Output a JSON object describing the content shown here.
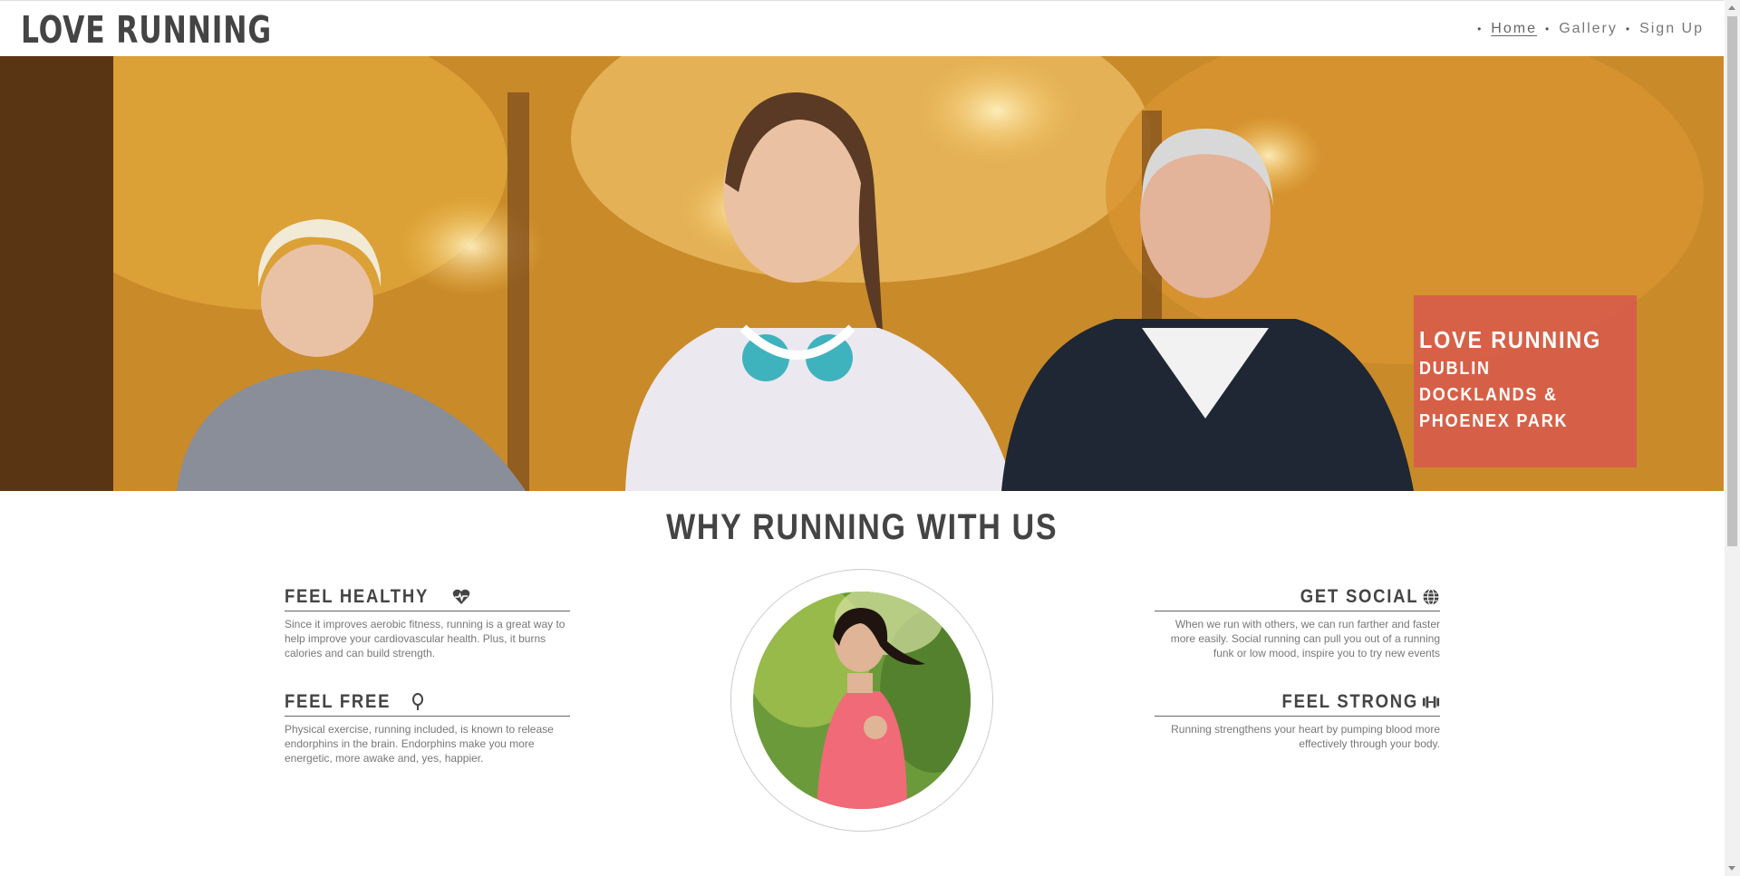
{
  "header": {
    "logo": "LOVE RUNNING",
    "nav": [
      {
        "label": "Home",
        "active": true
      },
      {
        "label": "Gallery",
        "active": false
      },
      {
        "label": "Sign Up",
        "active": false
      }
    ]
  },
  "hero": {
    "title": "LOVE RUNNING",
    "subtitle_line1": "DUBLIN DOCKLANDS &",
    "subtitle_line2": "PHOENEX PARK"
  },
  "section": {
    "title": "WHY RUNNING WITH US",
    "features": [
      {
        "title": "FEEL HEALTHY",
        "icon": "heartbeat-icon",
        "text": "Since it improves aerobic fitness, running is a great way to help improve your cardiovascular health. Plus, it burns calories and can build strength."
      },
      {
        "title": "FEEL FREE",
        "icon": "map-pin-icon",
        "text": "Physical exercise, running included, is known to release endorphins in the brain. Endorphins make you more energetic, more awake and, yes, happier."
      },
      {
        "title": "GET SOCIAL",
        "icon": "globe-icon",
        "text": "When we run with others, we can run farther and faster more easily. Social running can pull you out of a running funk or low mood, inspire you to try new events"
      },
      {
        "title": "FEEL STRONG",
        "icon": "dumbbell-icon",
        "text": "Running strengthens your heart by pumping blood more effectively through your body."
      }
    ]
  },
  "colors": {
    "card": "#d75a4b",
    "text": "#444444"
  }
}
